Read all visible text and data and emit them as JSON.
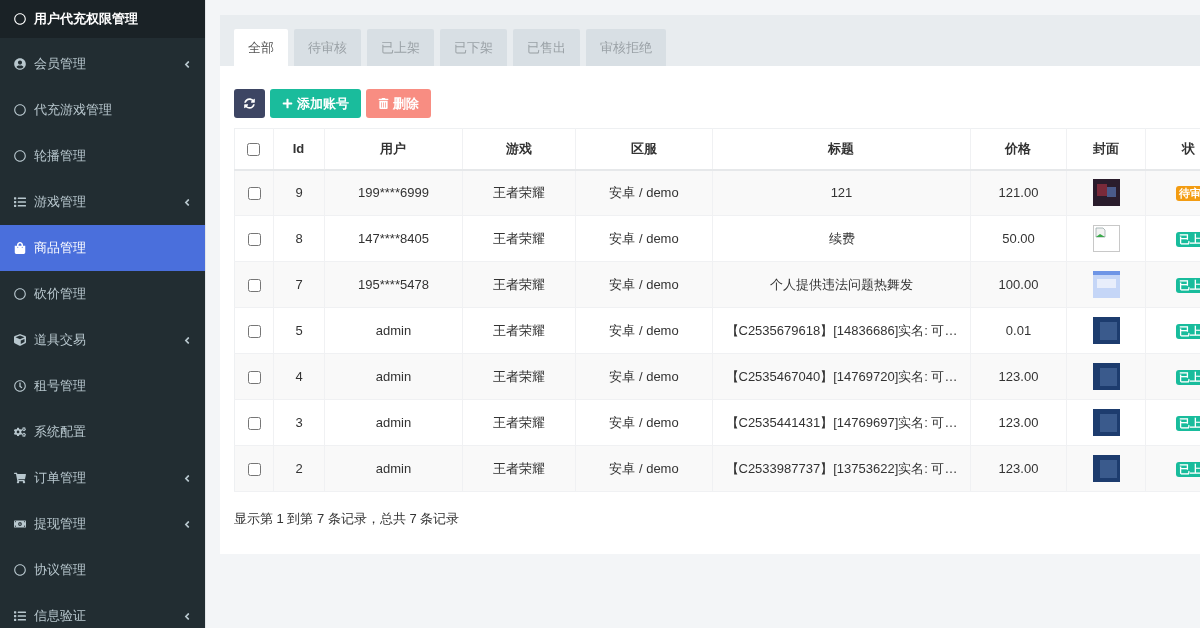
{
  "sidebar": {
    "heading": "用户代充权限管理",
    "items": [
      {
        "label": "会员管理",
        "expandable": true,
        "selected": false
      },
      {
        "label": "代充游戏管理",
        "expandable": false,
        "selected": false
      },
      {
        "label": "轮播管理",
        "expandable": false,
        "selected": false
      },
      {
        "label": "游戏管理",
        "expandable": true,
        "selected": false
      },
      {
        "label": "商品管理",
        "expandable": false,
        "selected": true
      },
      {
        "label": "砍价管理",
        "expandable": false,
        "selected": false
      },
      {
        "label": "道具交易",
        "expandable": true,
        "selected": false
      },
      {
        "label": "租号管理",
        "expandable": false,
        "selected": false
      },
      {
        "label": "系统配置",
        "expandable": false,
        "selected": false
      },
      {
        "label": "订单管理",
        "expandable": true,
        "selected": false
      },
      {
        "label": "提现管理",
        "expandable": true,
        "selected": false
      },
      {
        "label": "协议管理",
        "expandable": false,
        "selected": false
      },
      {
        "label": "信息验证",
        "expandable": true,
        "selected": false
      }
    ]
  },
  "tabs": [
    {
      "label": "全部",
      "selected": true
    },
    {
      "label": "待审核",
      "selected": false
    },
    {
      "label": "已上架",
      "selected": false
    },
    {
      "label": "已下架",
      "selected": false
    },
    {
      "label": "已售出",
      "selected": false
    },
    {
      "label": "审核拒绝",
      "selected": false
    }
  ],
  "toolbar": {
    "buttons": [
      {
        "kind": "refresh",
        "disabled": false
      },
      {
        "kind": "add",
        "label": "添加账号",
        "disabled": false
      },
      {
        "kind": "delete",
        "label": "删除",
        "disabled": true
      }
    ]
  },
  "table": {
    "select_all": {
      "checked": false
    },
    "columns": [
      "Id",
      "用户",
      "游戏",
      "区服",
      "标题",
      "价格",
      "封面",
      "状"
    ],
    "rows": [
      {
        "checked": false,
        "id": "9",
        "user": "199****6999",
        "game": "王者荣耀",
        "server": "安卓 / demo",
        "title": "121",
        "price": "121.00",
        "cover": {
          "kind": "dark-photo"
        },
        "status": {
          "label": "待审",
          "color": "#f39c12"
        }
      },
      {
        "checked": false,
        "id": "8",
        "user": "147****8405",
        "game": "王者荣耀",
        "server": "安卓 / demo",
        "title": "续费",
        "price": "50.00",
        "cover": {
          "kind": "broken"
        },
        "status": {
          "label": "已上",
          "color": "#18bc9c"
        }
      },
      {
        "checked": false,
        "id": "7",
        "user": "195****5478",
        "game": "王者荣耀",
        "server": "安卓 / demo",
        "title": "个人提供违法问题热舞发",
        "price": "100.00",
        "cover": {
          "kind": "light-screenshot"
        },
        "status": {
          "label": "已上",
          "color": "#18bc9c"
        }
      },
      {
        "checked": false,
        "id": "5",
        "user": "admin",
        "game": "王者荣耀",
        "server": "安卓 / demo",
        "title": "【C2535679618】[14836686]实名: 可…",
        "price": "0.01",
        "cover": {
          "kind": "game-screenshot"
        },
        "status": {
          "label": "已上",
          "color": "#18bc9c"
        }
      },
      {
        "checked": false,
        "id": "4",
        "user": "admin",
        "game": "王者荣耀",
        "server": "安卓 / demo",
        "title": "【C2535467040】[14769720]实名: 可…",
        "price": "123.00",
        "cover": {
          "kind": "game-screenshot"
        },
        "status": {
          "label": "已上",
          "color": "#18bc9c"
        }
      },
      {
        "checked": false,
        "id": "3",
        "user": "admin",
        "game": "王者荣耀",
        "server": "安卓 / demo",
        "title": "【C2535441431】[14769697]实名: 可…",
        "price": "123.00",
        "cover": {
          "kind": "game-screenshot"
        },
        "status": {
          "label": "已上",
          "color": "#18bc9c"
        }
      },
      {
        "checked": false,
        "id": "2",
        "user": "admin",
        "game": "王者荣耀",
        "server": "安卓 / demo",
        "title": "【C2533987737】[13753622]实名: 可…",
        "price": "123.00",
        "cover": {
          "kind": "game-screenshot"
        },
        "status": {
          "label": "已上",
          "color": "#18bc9c"
        }
      }
    ]
  },
  "footer": "显示第 1 到第 7 条记录，总共 7 条记录"
}
